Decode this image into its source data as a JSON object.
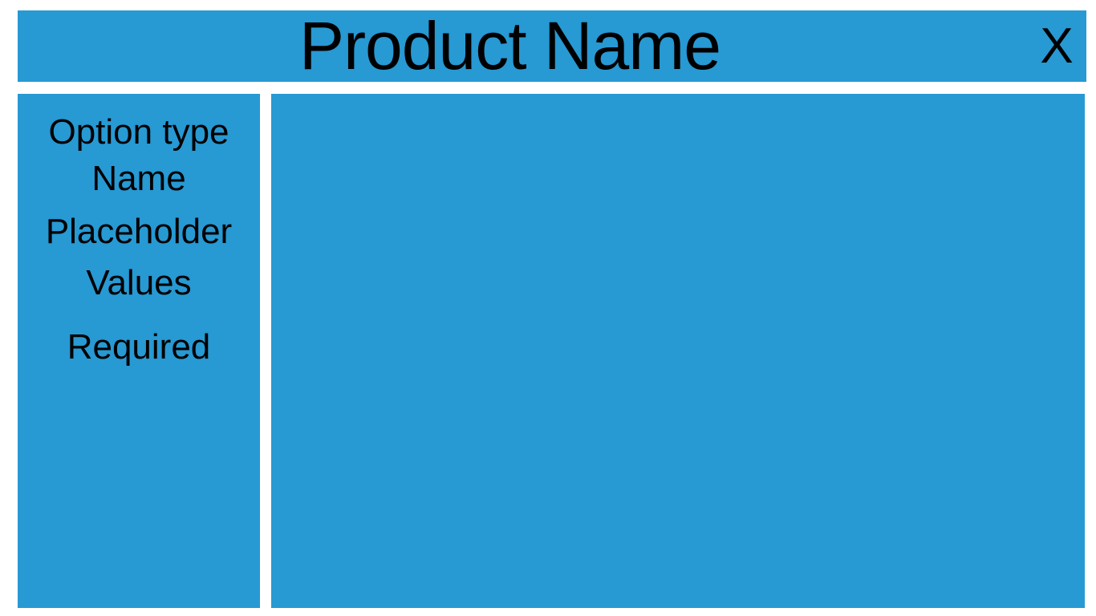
{
  "header": {
    "title": "Product Name",
    "close_label": "X"
  },
  "sidebar": {
    "items": [
      {
        "label": "Option type"
      },
      {
        "label": "Name"
      },
      {
        "label": "Placeholder"
      },
      {
        "label": "Values"
      },
      {
        "label": "Required"
      }
    ]
  },
  "colors": {
    "panel": "#2799d3",
    "background": "#ffffff",
    "text": "#000000"
  }
}
